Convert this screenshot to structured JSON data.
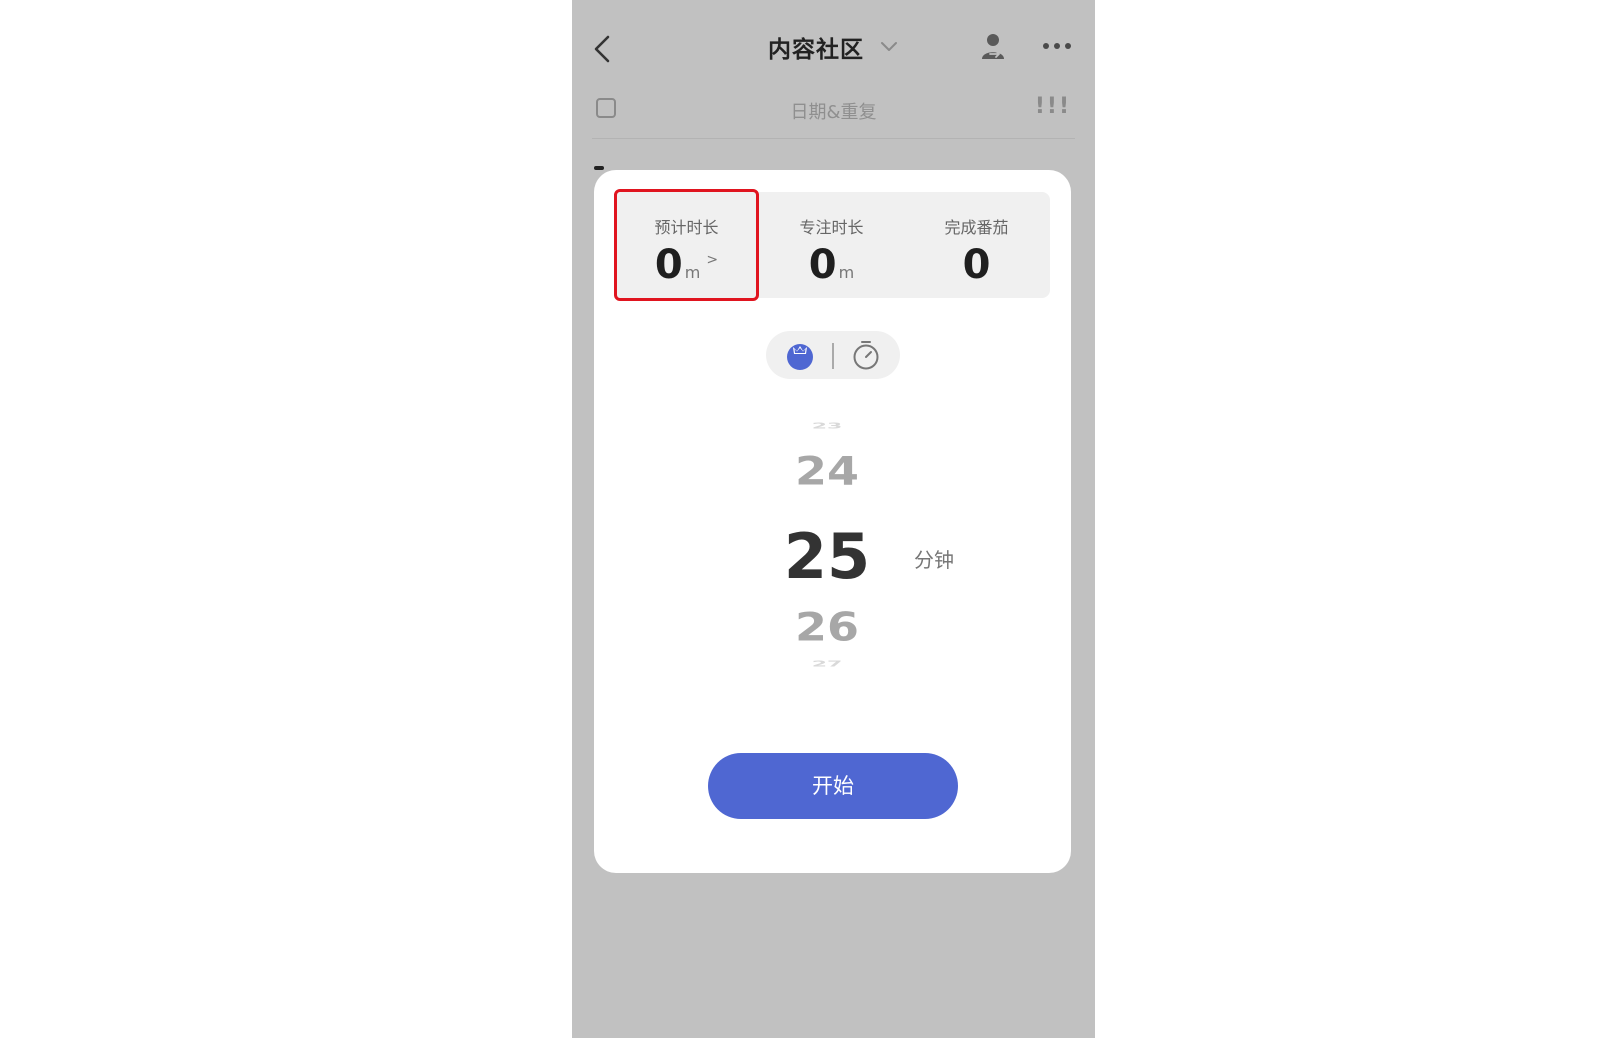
{
  "header": {
    "title": "内容社区",
    "icons": {
      "back": "back-arrow-icon",
      "dropdown": "chevron-down-icon",
      "share": "user-share-icon",
      "more": "more-icon"
    }
  },
  "task_toolbar": {
    "date_label": "日期&重复",
    "priority_label": "!!!"
  },
  "dialog": {
    "stats": [
      {
        "label": "预计时长",
        "value": "0",
        "unit": "m",
        "arrow": ">"
      },
      {
        "label": "专注时长",
        "value": "0",
        "unit": "m"
      },
      {
        "label": "完成番茄",
        "value": "0"
      }
    ],
    "mode_toggle": {
      "active": "pomodoro",
      "icons": [
        "tomato-icon",
        "stopwatch-icon"
      ]
    },
    "picker": {
      "values": [
        "23",
        "24",
        "25",
        "26",
        "27"
      ],
      "selected": "25",
      "unit": "分钟"
    },
    "start_button": "开始"
  },
  "colors": {
    "overlay": "#c1c1c1",
    "accent": "#4f67d2",
    "highlight": "#e0141f"
  }
}
